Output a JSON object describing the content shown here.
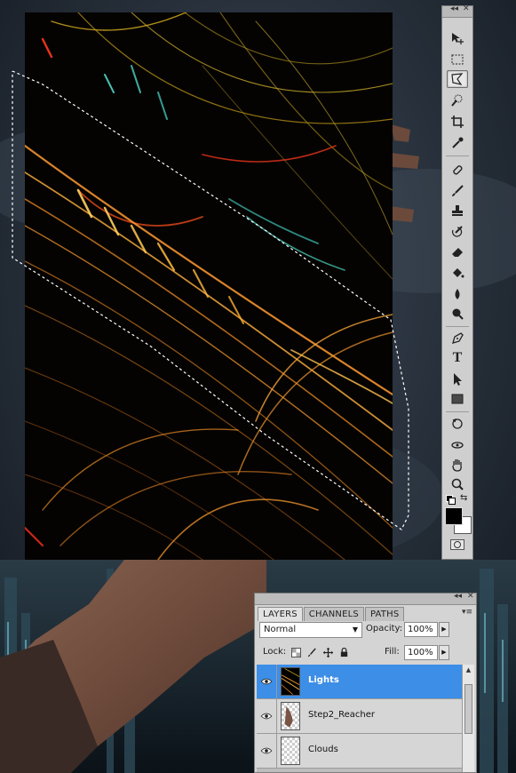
{
  "tools_panel": {
    "collapse_glyph": "◂◂",
    "close_glyph": "✕",
    "tools": [
      {
        "name": "move-tool-icon",
        "active": false
      },
      {
        "name": "marquee-tool-icon",
        "active": false
      },
      {
        "name": "polygonal-lasso-tool-icon",
        "active": true
      },
      {
        "name": "quick-selection-tool-icon",
        "active": false
      },
      {
        "name": "crop-tool-icon",
        "active": false
      },
      {
        "name": "eyedropper-tool-icon",
        "active": false
      },
      {
        "name": "healing-brush-tool-icon",
        "active": false
      },
      {
        "name": "brush-tool-icon",
        "active": false
      },
      {
        "name": "clone-stamp-tool-icon",
        "active": false
      },
      {
        "name": "history-brush-tool-icon",
        "active": false
      },
      {
        "name": "eraser-tool-icon",
        "active": false
      },
      {
        "name": "paint-bucket-tool-icon",
        "active": false
      },
      {
        "name": "blur-tool-icon",
        "active": false
      },
      {
        "name": "dodge-tool-icon",
        "active": false
      },
      {
        "name": "pen-tool-icon",
        "active": false
      },
      {
        "name": "type-tool-icon",
        "active": false
      },
      {
        "name": "path-selection-tool-icon",
        "active": false
      },
      {
        "name": "rectangle-tool-icon",
        "active": false
      },
      {
        "name": "3d-rotate-tool-icon",
        "active": false
      },
      {
        "name": "3d-orbit-tool-icon",
        "active": false
      },
      {
        "name": "hand-tool-icon",
        "active": false
      },
      {
        "name": "zoom-tool-icon",
        "active": false
      }
    ],
    "foreground_color": "#000000",
    "background_color": "#ffffff",
    "type_tool_glyph": "T"
  },
  "layers_panel": {
    "collapse_glyph": "◂◂",
    "close_glyph": "✕",
    "menu_glyph": "▾≡",
    "tabs": [
      "LAYERS",
      "CHANNELS",
      "PATHS"
    ],
    "active_tab": "LAYERS",
    "blend_mode": "Normal",
    "opacity_label": "Opacity:",
    "opacity_value": "100%",
    "lock_label": "Lock:",
    "fill_label": "Fill:",
    "fill_value": "100%",
    "layers": [
      {
        "name": "Lights",
        "selected": true,
        "visible": true
      },
      {
        "name": "Step2_Reacher",
        "selected": false,
        "visible": true
      },
      {
        "name": "Clouds",
        "selected": false,
        "visible": true
      }
    ]
  },
  "colors": {
    "selection_highlight": "#3d8ee6",
    "panel_gray": "#d4d4d4",
    "sky_dark": "#1b222c"
  }
}
